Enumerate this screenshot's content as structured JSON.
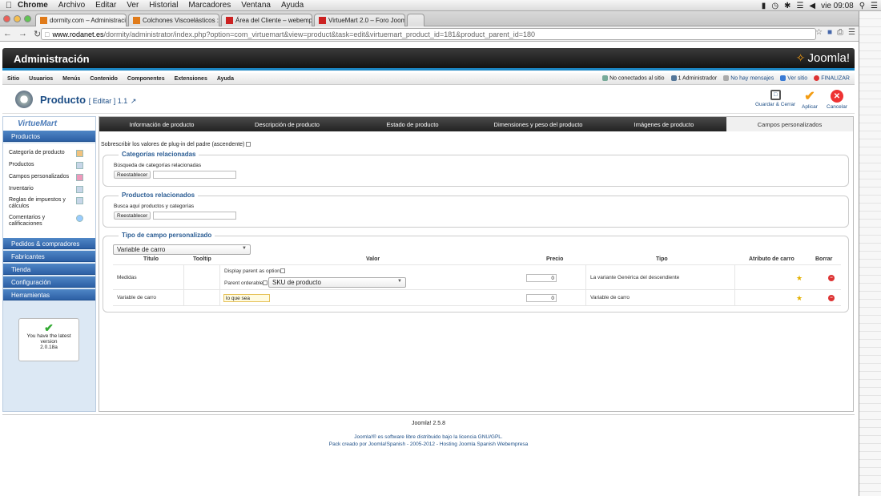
{
  "mac_menu": {
    "items": [
      "Chrome",
      "Archivo",
      "Editar",
      "Ver",
      "Historial",
      "Marcadores",
      "Ventana",
      "Ayuda"
    ],
    "clock": "vie 09:08"
  },
  "browser": {
    "tabs": [
      {
        "label": "dormity.com – Administraci",
        "color": "#e07b1a"
      },
      {
        "label": "Colchones Viscoelásticos : 1",
        "color": "#e07b1a"
      },
      {
        "label": "Área del Cliente – webemp",
        "color": "#c22"
      },
      {
        "label": "VirtueMart 2.0 – Foro Joom",
        "color": "#c22"
      }
    ],
    "url_host": "www.rodanet.es",
    "url_path": "/dormity/administrator/index.php?option=com_virtuemart&view=product&task=edit&virtuemart_product_id=181&product_parent_id=180"
  },
  "admin": {
    "title": "Administración",
    "logo": "Joomla!",
    "menu": [
      "Sitio",
      "Usuarios",
      "Menús",
      "Contenido",
      "Componentes",
      "Extensiones",
      "Ayuda"
    ],
    "status": {
      "visitors": "No conectados al sitio",
      "admins": "1 Administrador",
      "messages": "No hay mensajes",
      "view_site": "Ver sitio",
      "logout": "FINALIZAR"
    }
  },
  "toolbar": {
    "title": "Producto",
    "subtitle": "[ Editar ] 1.1",
    "save_close": "Guardar & Cerrar",
    "apply": "Aplicar",
    "cancel": "Cancelar"
  },
  "sidebar": {
    "logo": "VirtueMart",
    "products_head": "Productos",
    "items": [
      "Categoría de producto",
      "Productos",
      "Campos personalizados",
      "Inventario",
      "Reglas de impuestos y cálculos",
      "Comentarios y calificaciones"
    ],
    "sections": [
      "Pedidos & compradores",
      "Fabricantes",
      "Tienda",
      "Configuración",
      "Herramientas"
    ],
    "latest": {
      "line1": "You have the latest",
      "line2": "version",
      "line3": "2.0.18a"
    }
  },
  "content": {
    "tabs": [
      "Información de producto",
      "Descripción de producto",
      "Estado de producto",
      "Dimensiones y peso del producto",
      "Imágenes de producto",
      "Campos personalizados"
    ],
    "override_label": "Sobrescribir los valores de plug-in del padre (ascendente)",
    "related_categories": {
      "legend": "Categorías relacionadas",
      "search_label": "Búsqueda de categorías relacionadas",
      "reset": "Reestablecer"
    },
    "related_products": {
      "legend": "Productos relacionados",
      "search_label": "Busca aquí productos y categorías",
      "reset": "Reestablecer"
    },
    "custom_field": {
      "legend": "Tipo de campo personalizado",
      "select_value": "Variable de carro",
      "headers": [
        "Título",
        "Tooltip",
        "Valor",
        "Precio",
        "Tipo",
        "Atributo de carro",
        "Borrar"
      ],
      "rows": [
        {
          "title": "Medidas",
          "display_parent": "Display parent as option",
          "parent_orderable": "Parent orderable",
          "sku_select": "SKU de producto",
          "price": "0",
          "type": "La variante Genérica del descendiente"
        },
        {
          "title": "Variable de carro",
          "value": "lo que sea",
          "price": "0",
          "type": "Variable de carro"
        }
      ]
    }
  },
  "footer": {
    "version": "Joomla! 2.5.8",
    "line1": "Joomla!® es software libre distribuido bajo la licencia GNU/GPL.",
    "line2": "Pack creado por Joomla!Spanish - 2005-2012 - Hosting Joomla Spanish Webempresa"
  }
}
